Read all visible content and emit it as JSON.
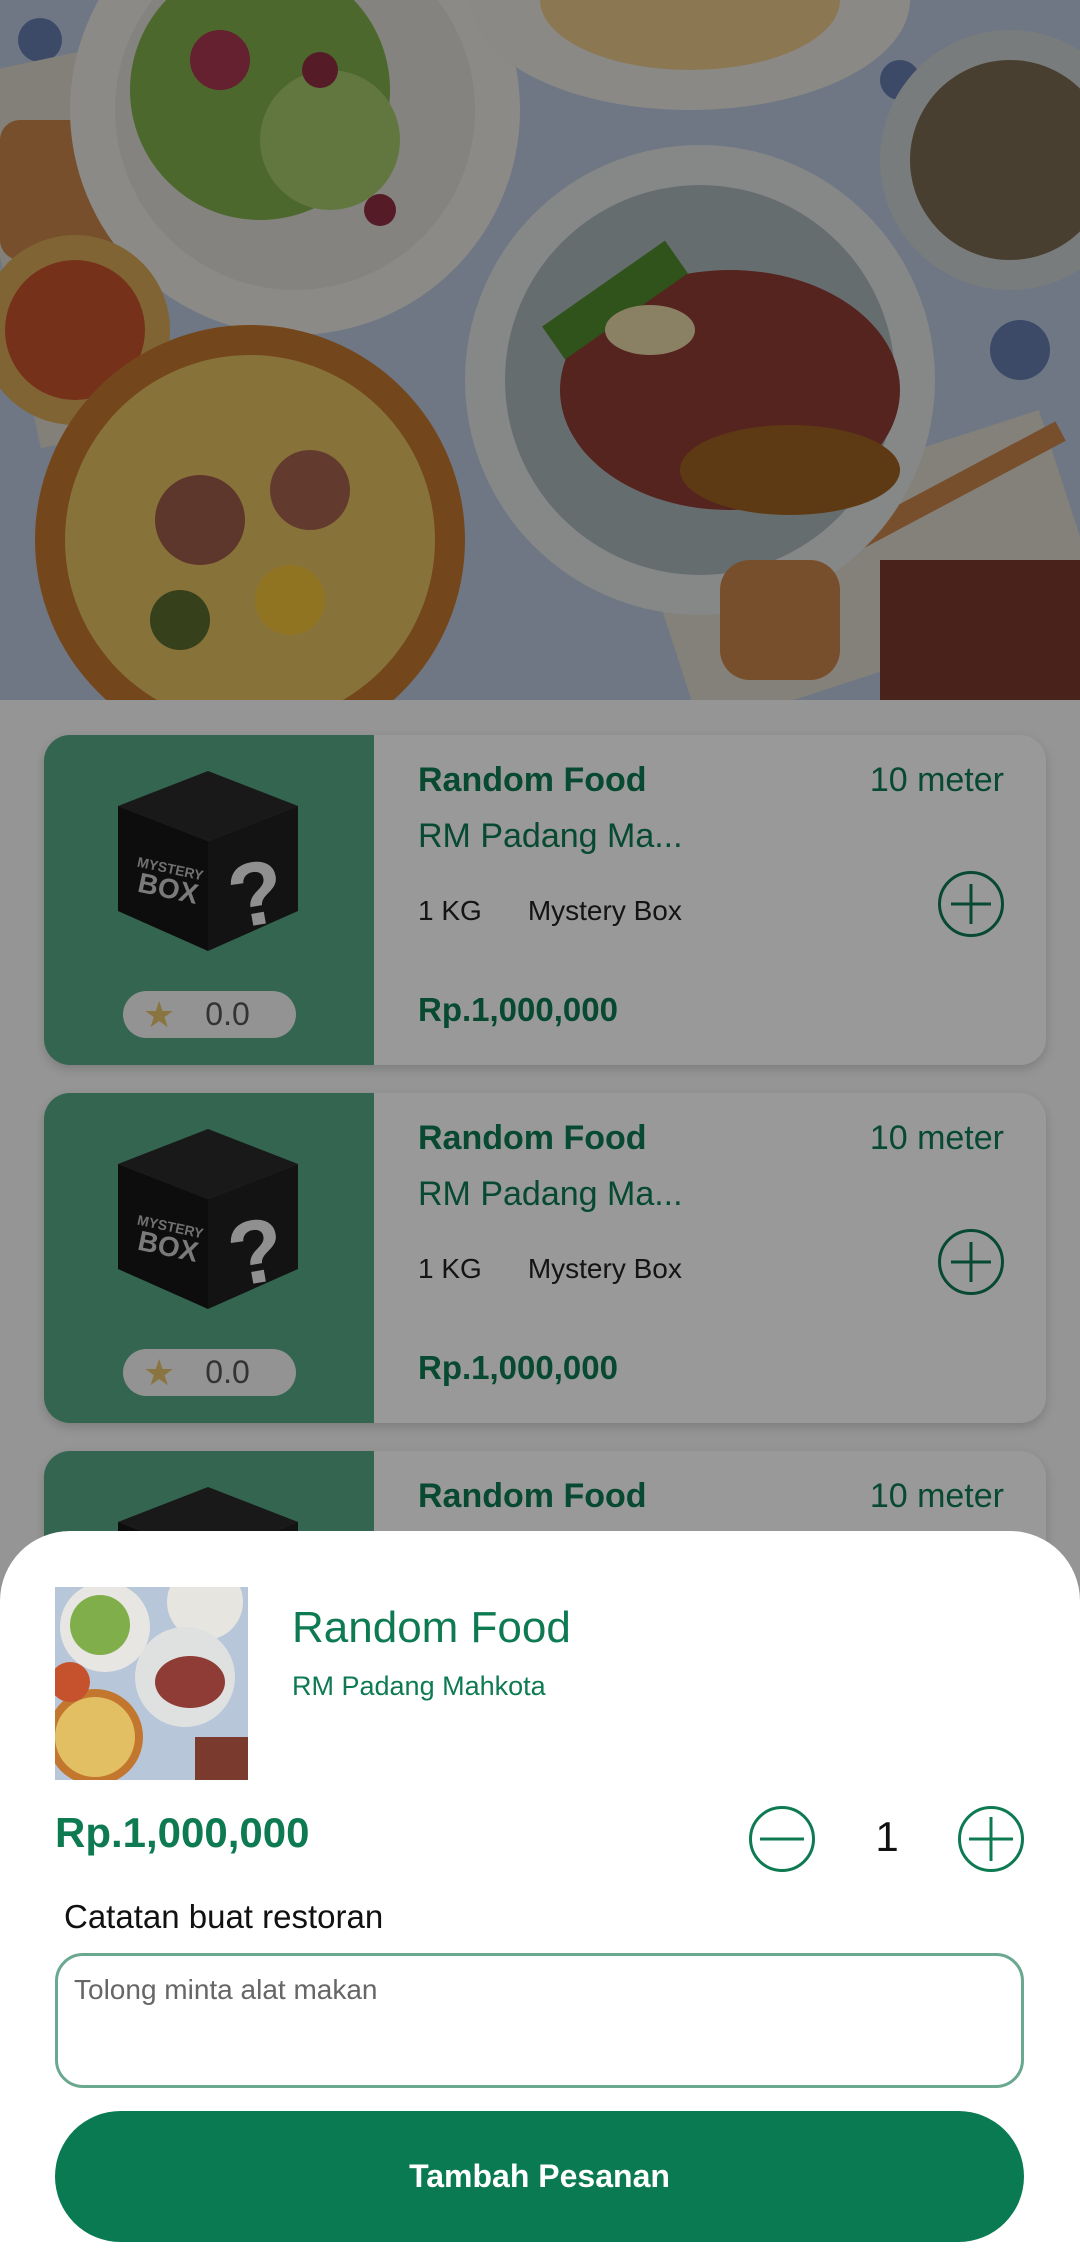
{
  "list": {
    "items": [
      {
        "title": "Random Food",
        "distance": "10 meter",
        "restaurant": "RM Padang Ma...",
        "weight": "1 KG",
        "category": "Mystery Box",
        "price": "Rp.1,000,000",
        "rating": "0.0"
      },
      {
        "title": "Random Food",
        "distance": "10 meter",
        "restaurant": "RM Padang Ma...",
        "weight": "1 KG",
        "category": "Mystery Box",
        "price": "Rp.1,000,000",
        "rating": "0.0"
      },
      {
        "title": "Random Food",
        "distance": "10 meter"
      }
    ]
  },
  "sheet": {
    "title": "Random Food",
    "restaurant": "RM Padang Mahkota",
    "price": "Rp.1,000,000",
    "quantity": "1",
    "note_label": "Catatan buat restoran",
    "note_placeholder": "Tolong minta alat makan",
    "submit_label": "Tambah Pesanan"
  },
  "colors": {
    "accent": "#0a7a52",
    "thumb_bg": "#56a986",
    "star": "#e6c16a"
  },
  "icons": {
    "add": "plus-circle-icon",
    "minus": "minus-circle-icon",
    "star": "star-icon",
    "mystery_box": "mystery-box-icon"
  }
}
